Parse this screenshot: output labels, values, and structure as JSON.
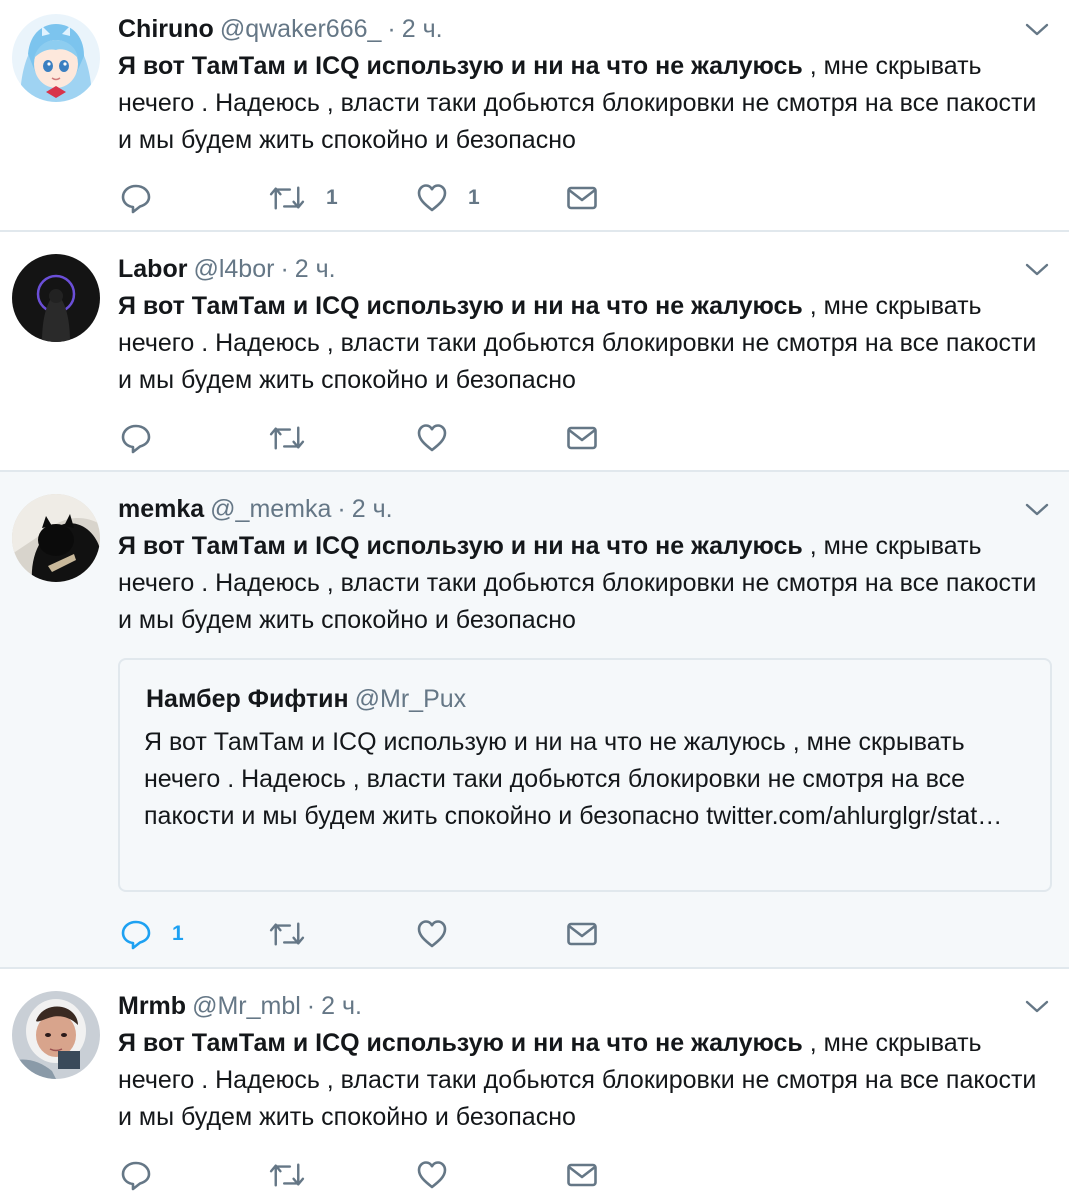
{
  "tweets": [
    {
      "name": "Chiruno",
      "handle": "@qwaker666_",
      "dot": "·",
      "time": "2 ч.",
      "text_bold": "Я вот ТамТам и ICQ использую и ни на что не жалуюсь",
      "text_rest": " , мне скрывать нечего . Надеюсь , власти таки добьются блокировки не смотря на все пакости и мы будем жить спокойно и безопасно",
      "retweets": "1",
      "likes": "1"
    },
    {
      "name": "Labor",
      "handle": "@l4bor",
      "dot": "·",
      "time": "2 ч.",
      "text_bold": "Я вот ТамТам и ICQ использую и ни на что не жалуюсь",
      "text_rest": " , мне скрывать нечего . Надеюсь , власти таки добьются блокировки не смотря на все пакости и мы будем жить спокойно и безопасно"
    },
    {
      "name": "memka",
      "handle": "@_memka",
      "dot": "·",
      "time": "2 ч.",
      "text_bold": "Я вот ТамТам и ICQ использую и ни на что не жалуюсь",
      "text_rest": " , мне скрывать нечего . Надеюсь , власти таки добьются блокировки не смотря на все пакости и мы будем жить спокойно и безопасно",
      "replies": "1",
      "quote": {
        "name": "Намбер Фифтин",
        "handle": "@Mr_Pux",
        "text": "Я вот ТамТам и ICQ использую и ни на что не жалуюсь , мне скрывать нечего . Надеюсь , власти таки добьются блокировки не смотря на все пакости и мы будем жить спокойно и безопасно twitter.com/ahlurglgr/stat…"
      }
    },
    {
      "name": "Mrmb",
      "handle": "@Mr_mbl",
      "dot": "·",
      "time": "2 ч.",
      "text_bold": "Я вот ТамТам и ICQ использую и ни на что не жалуюсь",
      "text_rest": " , мне скрывать нечего . Надеюсь , власти таки добьются блокировки не смотря на все пакости и мы будем жить спокойно и безопасно"
    }
  ],
  "icons": [
    "reply-icon",
    "retweet-icon",
    "like-icon",
    "direct-message-icon",
    "more-caret-icon"
  ],
  "colors": {
    "text": "#14171a",
    "muted": "#657786",
    "accent": "#1da1f2",
    "border": "#e1e8ed",
    "highlight_bg": "#f5f8fa"
  }
}
